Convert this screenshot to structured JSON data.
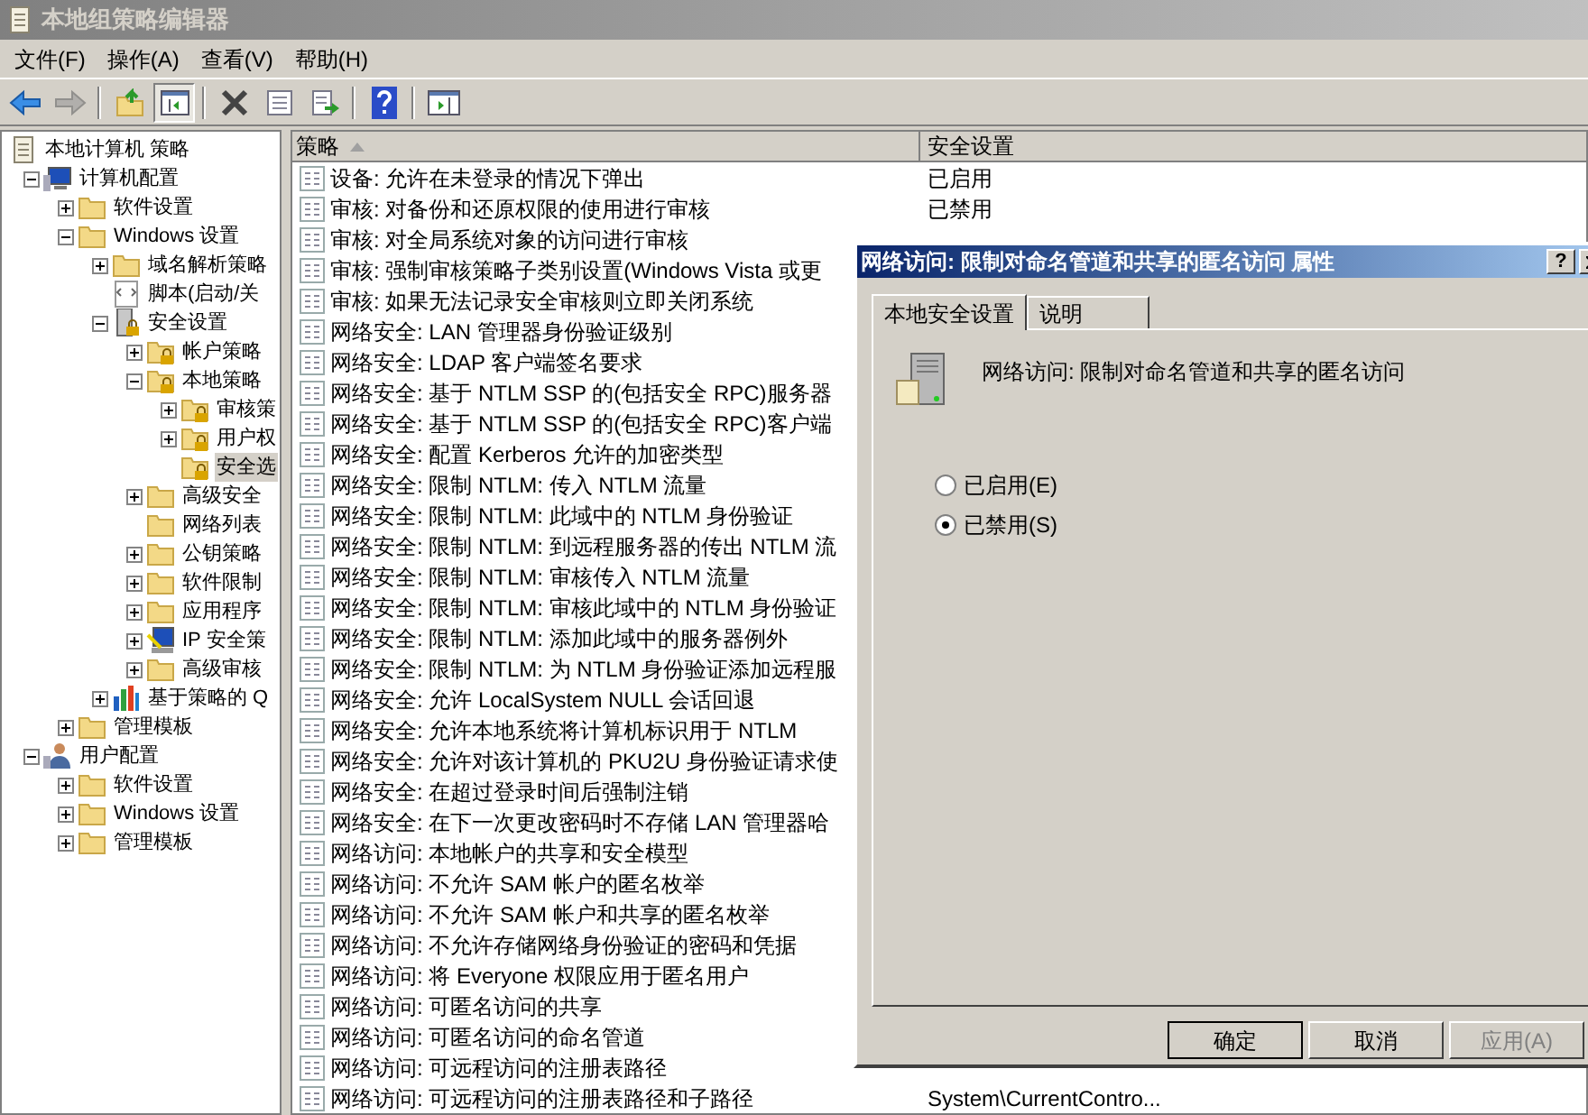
{
  "window": {
    "title": "本地组策略编辑器"
  },
  "menu": [
    "文件(F)",
    "操作(A)",
    "查看(V)",
    "帮助(H)"
  ],
  "toolbar": [
    {
      "kind": "back",
      "disabled": false,
      "pressed": false
    },
    {
      "kind": "forward",
      "disabled": true,
      "pressed": false
    },
    {
      "kind": "up",
      "disabled": false,
      "pressed": false
    },
    {
      "kind": "tree",
      "disabled": false,
      "pressed": true
    },
    {
      "kind": "delete",
      "disabled": false,
      "pressed": false
    },
    {
      "kind": "properties",
      "disabled": false,
      "pressed": false
    },
    {
      "kind": "export",
      "disabled": false,
      "pressed": false
    },
    {
      "kind": "help",
      "disabled": false,
      "pressed": false
    },
    {
      "kind": "pane",
      "disabled": false,
      "pressed": false
    }
  ],
  "tree": [
    {
      "label": "本地计算机 策略",
      "kind": "policy",
      "selected": false,
      "children": [
        {
          "label": "计算机配置",
          "kind": "computer",
          "expanded": true,
          "selected": false,
          "children": [
            {
              "label": "软件设置",
              "kind": "folder",
              "expanded": false,
              "selected": false
            },
            {
              "label": "Windows 设置",
              "kind": "folder",
              "expanded": true,
              "selected": false,
              "children": [
                {
                  "label": "域名解析策略",
                  "kind": "folder",
                  "expanded": false,
                  "selected": false
                },
                {
                  "label": "脚本(启动/关",
                  "kind": "script",
                  "selected": false
                },
                {
                  "label": "安全设置",
                  "kind": "server",
                  "expanded": true,
                  "selected": false,
                  "children": [
                    {
                      "label": "帐户策略",
                      "kind": "lockfolder",
                      "expanded": false,
                      "selected": false
                    },
                    {
                      "label": "本地策略",
                      "kind": "lockfolder",
                      "expanded": true,
                      "selected": false,
                      "children": [
                        {
                          "label": "审核策",
                          "kind": "lockfolder",
                          "expanded": false,
                          "selected": false
                        },
                        {
                          "label": "用户权",
                          "kind": "lockfolder",
                          "expanded": false,
                          "selected": false
                        },
                        {
                          "label": "安全选",
                          "kind": "lockfolder",
                          "selected": true
                        }
                      ]
                    },
                    {
                      "label": "高级安全",
                      "kind": "folder",
                      "expanded": false,
                      "selected": false
                    },
                    {
                      "label": "网络列表",
                      "kind": "folder",
                      "selected": false
                    },
                    {
                      "label": "公钥策略",
                      "kind": "folder",
                      "expanded": false,
                      "selected": false
                    },
                    {
                      "label": "软件限制",
                      "kind": "folder",
                      "expanded": false,
                      "selected": false
                    },
                    {
                      "label": "应用程序",
                      "kind": "folder",
                      "expanded": false,
                      "selected": false
                    },
                    {
                      "label": "IP 安全策",
                      "kind": "ip",
                      "expanded": false,
                      "selected": false
                    },
                    {
                      "label": "高级审核",
                      "kind": "folder",
                      "expanded": false,
                      "selected": false
                    }
                  ]
                },
                {
                  "label": "基于策略的 Q",
                  "kind": "chart",
                  "expanded": false,
                  "selected": false
                }
              ]
            },
            {
              "label": "管理模板",
              "kind": "folder",
              "expanded": false,
              "selected": false
            }
          ]
        },
        {
          "label": "用户配置",
          "kind": "user",
          "expanded": true,
          "selected": false,
          "children": [
            {
              "label": "软件设置",
              "kind": "folder",
              "expanded": false,
              "selected": false
            },
            {
              "label": "Windows 设置",
              "kind": "folder",
              "expanded": false,
              "selected": false
            },
            {
              "label": "管理模板",
              "kind": "folder",
              "expanded": false,
              "selected": false
            }
          ]
        }
      ]
    }
  ],
  "table": {
    "columns": [
      "策略",
      "安全设置"
    ],
    "rows": [
      {
        "policy": "设备: 允许在未登录的情况下弹出",
        "setting": "已启用"
      },
      {
        "policy": "审核: 对备份和还原权限的使用进行审核",
        "setting": "已禁用"
      },
      {
        "policy": "审核: 对全局系统对象的访问进行审核"
      },
      {
        "policy": "审核: 强制审核策略子类别设置(Windows Vista 或更"
      },
      {
        "policy": "审核: 如果无法记录安全审核则立即关闭系统"
      },
      {
        "policy": "网络安全: LAN 管理器身份验证级别"
      },
      {
        "policy": "网络安全: LDAP 客户端签名要求"
      },
      {
        "policy": "网络安全: 基于 NTLM SSP 的(包括安全 RPC)服务器"
      },
      {
        "policy": "网络安全: 基于 NTLM SSP 的(包括安全 RPC)客户端"
      },
      {
        "policy": "网络安全: 配置 Kerberos 允许的加密类型"
      },
      {
        "policy": "网络安全: 限制 NTLM: 传入 NTLM 流量"
      },
      {
        "policy": "网络安全: 限制 NTLM: 此域中的 NTLM 身份验证"
      },
      {
        "policy": "网络安全: 限制 NTLM: 到远程服务器的传出 NTLM 流"
      },
      {
        "policy": "网络安全: 限制 NTLM: 审核传入 NTLM 流量"
      },
      {
        "policy": "网络安全: 限制 NTLM: 审核此域中的 NTLM 身份验证"
      },
      {
        "policy": "网络安全: 限制 NTLM: 添加此域中的服务器例外"
      },
      {
        "policy": "网络安全: 限制 NTLM: 为 NTLM 身份验证添加远程服"
      },
      {
        "policy": "网络安全: 允许 LocalSystem NULL 会话回退"
      },
      {
        "policy": "网络安全: 允许本地系统将计算机标识用于 NTLM"
      },
      {
        "policy": "网络安全: 允许对该计算机的 PKU2U 身份验证请求使"
      },
      {
        "policy": "网络安全: 在超过登录时间后强制注销"
      },
      {
        "policy": "网络安全: 在下一次更改密码时不存储 LAN 管理器哈"
      },
      {
        "policy": "网络访问: 本地帐户的共享和安全模型"
      },
      {
        "policy": "网络访问: 不允许 SAM 帐户的匿名枚举"
      },
      {
        "policy": "网络访问: 不允许 SAM 帐户和共享的匿名枚举"
      },
      {
        "policy": "网络访问: 不允许存储网络身份验证的密码和凭据"
      },
      {
        "policy": "网络访问: 将 Everyone 权限应用于匿名用户"
      },
      {
        "policy": "网络访问: 可匿名访问的共享"
      },
      {
        "policy": "网络访问: 可匿名访问的命名管道"
      },
      {
        "policy": "网络访问: 可远程访问的注册表路径"
      },
      {
        "policy": "网络访问: 可远程访问的注册表路径和子路径",
        "setting": "System\\CurrentContro..."
      }
    ]
  },
  "dialog": {
    "title": "网络访问: 限制对命名管道和共享的匿名访问 属性",
    "help": "?",
    "tabs": [
      {
        "label": "本地安全设置",
        "selected": true
      },
      {
        "label": "说明",
        "selected": false
      }
    ],
    "policy_name": "网络访问: 限制对命名管道和共享的匿名访问",
    "options": [
      {
        "label": "已启用(E)",
        "selected": false
      },
      {
        "label": "已禁用(S)",
        "selected": true
      }
    ],
    "buttons": [
      {
        "label": "确定",
        "disabled": false,
        "default": true
      },
      {
        "label": "取消",
        "disabled": false,
        "default": false
      },
      {
        "label": "应用(A)",
        "disabled": true,
        "default": false
      }
    ]
  }
}
